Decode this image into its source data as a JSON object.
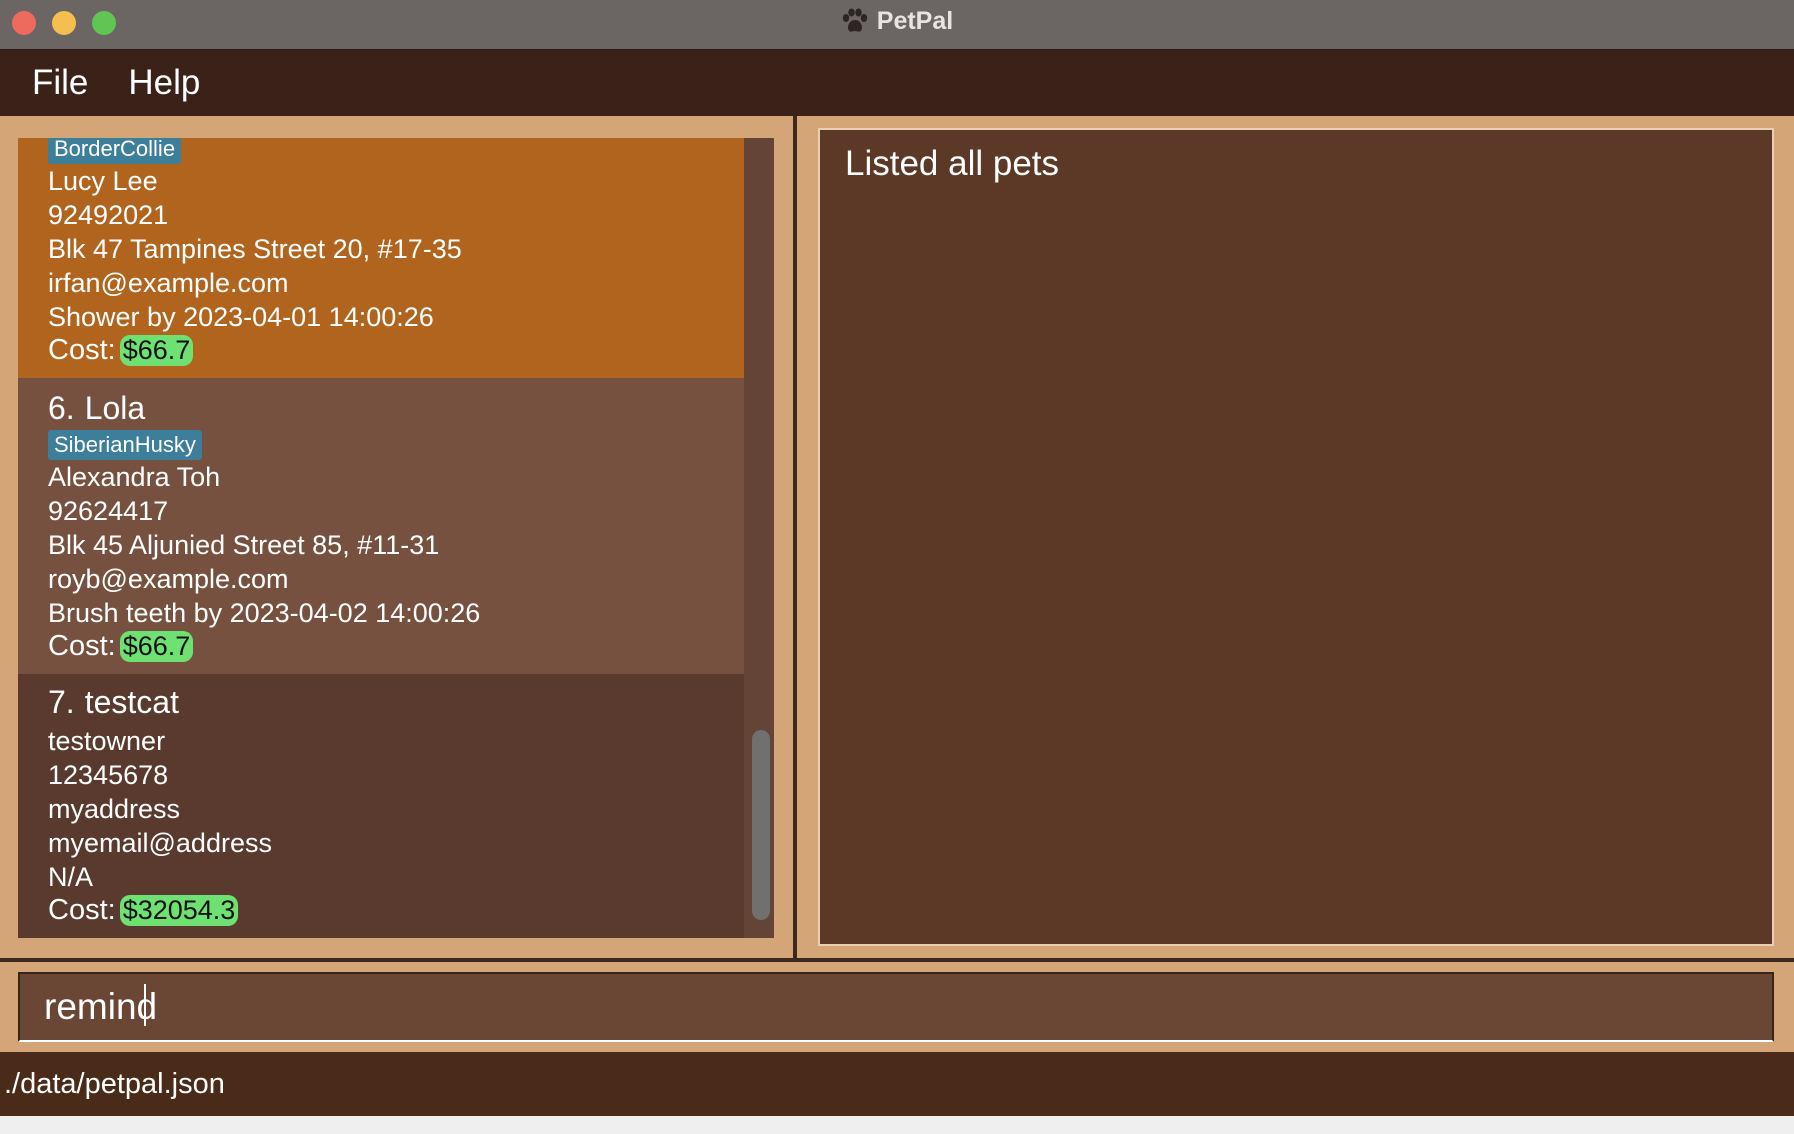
{
  "window": {
    "title": "PetPal"
  },
  "menu": {
    "file": "File",
    "help": "Help"
  },
  "pets": {
    "cost_label": "Cost:",
    "selected": {
      "tag": "BorderCollie",
      "owner": "Lucy Lee",
      "phone": "92492021",
      "address": "Blk 47 Tampines Street 20, #17-35",
      "email": "irfan@example.com",
      "reminder": "Shower by 2023-04-01 14:00:26",
      "cost": "$66.7"
    },
    "lola": {
      "index": "6.",
      "name": "Lola",
      "tag": "SiberianHusky",
      "owner": "Alexandra Toh",
      "phone": "92624417",
      "address": "Blk 45 Aljunied Street 85, #11-31",
      "email": "royb@example.com",
      "reminder": "Brush teeth by 2023-04-02 14:00:26",
      "cost": "$66.7"
    },
    "testcat": {
      "index": "7.",
      "name": "testcat",
      "owner": "testowner",
      "phone": "12345678",
      "address": "myaddress",
      "email": "myemail@address",
      "reminder": "N/A",
      "cost": "$32054.3"
    }
  },
  "result": {
    "message": "Listed all pets"
  },
  "command": {
    "value": "remind"
  },
  "status": {
    "file_path": "./data/petpal.json"
  },
  "colors": {
    "selected_card": "#b1641d",
    "tag": "#3d7e9a",
    "cost_badge": "#6fe072"
  }
}
